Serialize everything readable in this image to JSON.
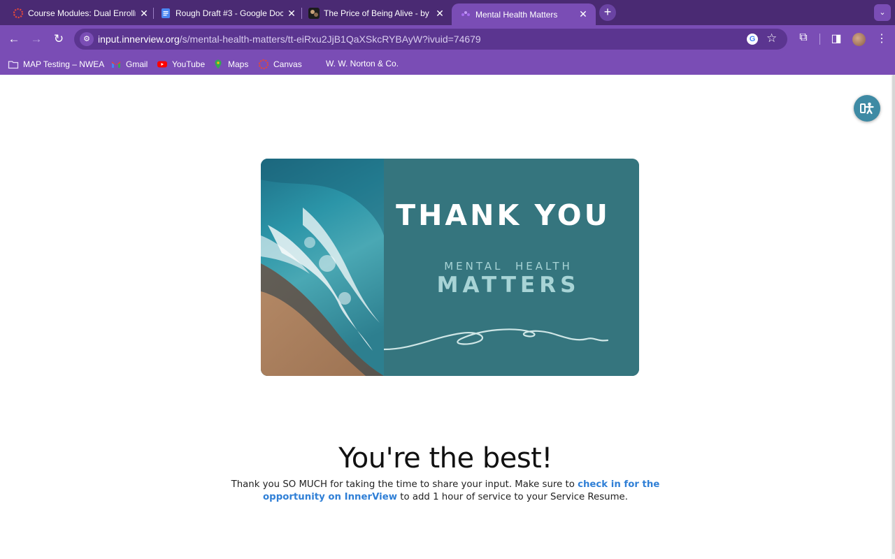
{
  "tabs": [
    {
      "title": "Course Modules: Dual Enrollm",
      "favicon": "canvas-icon",
      "active": false
    },
    {
      "title": "Rough Draft #3 - Google Doc",
      "favicon": "google-docs-icon",
      "active": false
    },
    {
      "title": "The Price of Being Alive - by",
      "favicon": "article-thumbnail-icon",
      "active": false
    },
    {
      "title": "Mental Health Matters",
      "favicon": "innerview-icon",
      "active": true
    }
  ],
  "toolbar": {
    "url_host": "input.innerview.org",
    "url_path": "/s/mental-health-matters/tt-eiRxu2JjB1QaXSkcRYBAyW?ivuid=74679"
  },
  "bookmarks": [
    {
      "label": "MAP Testing – NWEA",
      "icon": "folder-icon"
    },
    {
      "label": "Gmail",
      "icon": "gmail-icon"
    },
    {
      "label": "YouTube",
      "icon": "youtube-icon"
    },
    {
      "label": "Maps",
      "icon": "maps-icon"
    },
    {
      "label": "Canvas",
      "icon": "canvas-icon"
    },
    {
      "label": "W. W. Norton & Co.",
      "icon": ""
    }
  ],
  "banner": {
    "title": "THANK YOU",
    "subtitle": "MENTAL  HEALTH",
    "subtitle_big": "MATTERS"
  },
  "content": {
    "headline": "You're the best!",
    "message_before": "Thank you SO MUCH for taking the time to share your input. Make sure to ",
    "link_text": "check in for the opportunity on InnerView",
    "message_after": " to add 1 hour of service to your Service Resume."
  },
  "colors": {
    "chrome_dark": "#4a2a73",
    "chrome": "#7a4db5",
    "banner_teal": "#35757e",
    "link": "#2f7fd6",
    "accessibility_button": "#3e8aa4"
  }
}
